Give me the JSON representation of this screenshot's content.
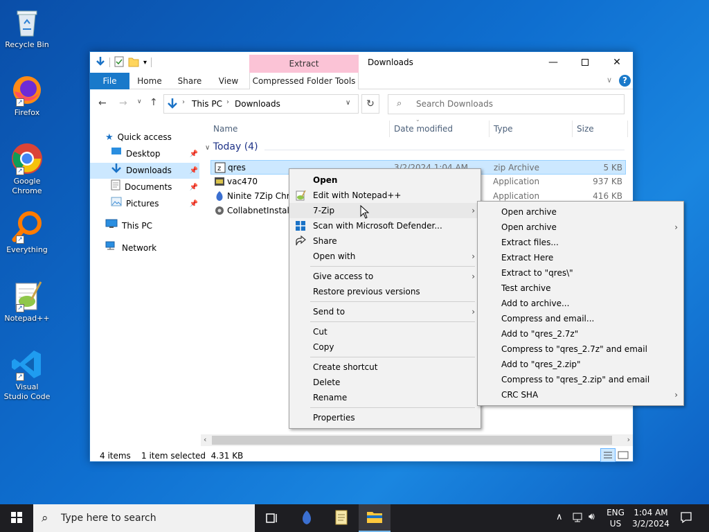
{
  "desktop": {
    "icons": [
      {
        "label": "Recycle Bin"
      },
      {
        "label": "Firefox"
      },
      {
        "label": "Google Chrome"
      },
      {
        "label": "Everything"
      },
      {
        "label": "Notepad++"
      },
      {
        "label": "Visual Studio Code"
      }
    ]
  },
  "window": {
    "title": "Downloads",
    "context_tab_group": "Extract",
    "tabs": [
      "File",
      "Home",
      "Share",
      "View",
      "Compressed Folder Tools"
    ],
    "breadcrumb": [
      "This PC",
      "Downloads"
    ],
    "search_placeholder": "Search Downloads"
  },
  "nav": {
    "quick_access": "Quick access",
    "items": [
      "Desktop",
      "Downloads",
      "Documents",
      "Pictures"
    ],
    "this_pc": "This PC",
    "network": "Network"
  },
  "columns": {
    "name": "Name",
    "date": "Date modified",
    "type": "Type",
    "size": "Size"
  },
  "group": {
    "label": "Today (4)"
  },
  "files": [
    {
      "name": "qres",
      "date": "3/2/2024 1:04 AM",
      "type": "zip Archive",
      "size": "5 KB"
    },
    {
      "name": "vac470",
      "date": "",
      "type": "Application",
      "size": "937 KB"
    },
    {
      "name": "Ninite 7Zip Chrome",
      "date": "",
      "type": "Application",
      "size": "416 KB"
    },
    {
      "name": "CollabnetInstaller",
      "date": "",
      "type": "",
      "size": ""
    }
  ],
  "status": {
    "count": "4 items",
    "selected": "1 item selected  4.31 KB"
  },
  "context_menu": {
    "items": [
      "Open",
      "Edit with Notepad++",
      "7-Zip",
      "Scan with Microsoft Defender...",
      "Share",
      "Open with",
      "Give access to",
      "Restore previous versions",
      "Send to",
      "Cut",
      "Copy",
      "Create shortcut",
      "Delete",
      "Rename",
      "Properties"
    ]
  },
  "submenu": {
    "items": [
      "Open archive",
      "Open archive",
      "Extract files...",
      "Extract Here",
      "Extract to \"qres\\\"",
      "Test archive",
      "Add to archive...",
      "Compress and email...",
      "Add to \"qres_2.7z\"",
      "Compress to \"qres_2.7z\" and email",
      "Add to \"qres_2.zip\"",
      "Compress to \"qres_2.zip\" and email",
      "CRC SHA"
    ]
  },
  "taskbar": {
    "search_placeholder": "Type here to search",
    "lang_top": "ENG",
    "lang_bottom": "US",
    "time": "1:04 AM",
    "date": "3/2/2024"
  },
  "colors": {
    "accent": "#1979ca",
    "context_tab": "#fbc3d6",
    "selection": "#cce8ff",
    "menu_bg": "#f2f2f2",
    "taskbar": "#1e1e22"
  }
}
